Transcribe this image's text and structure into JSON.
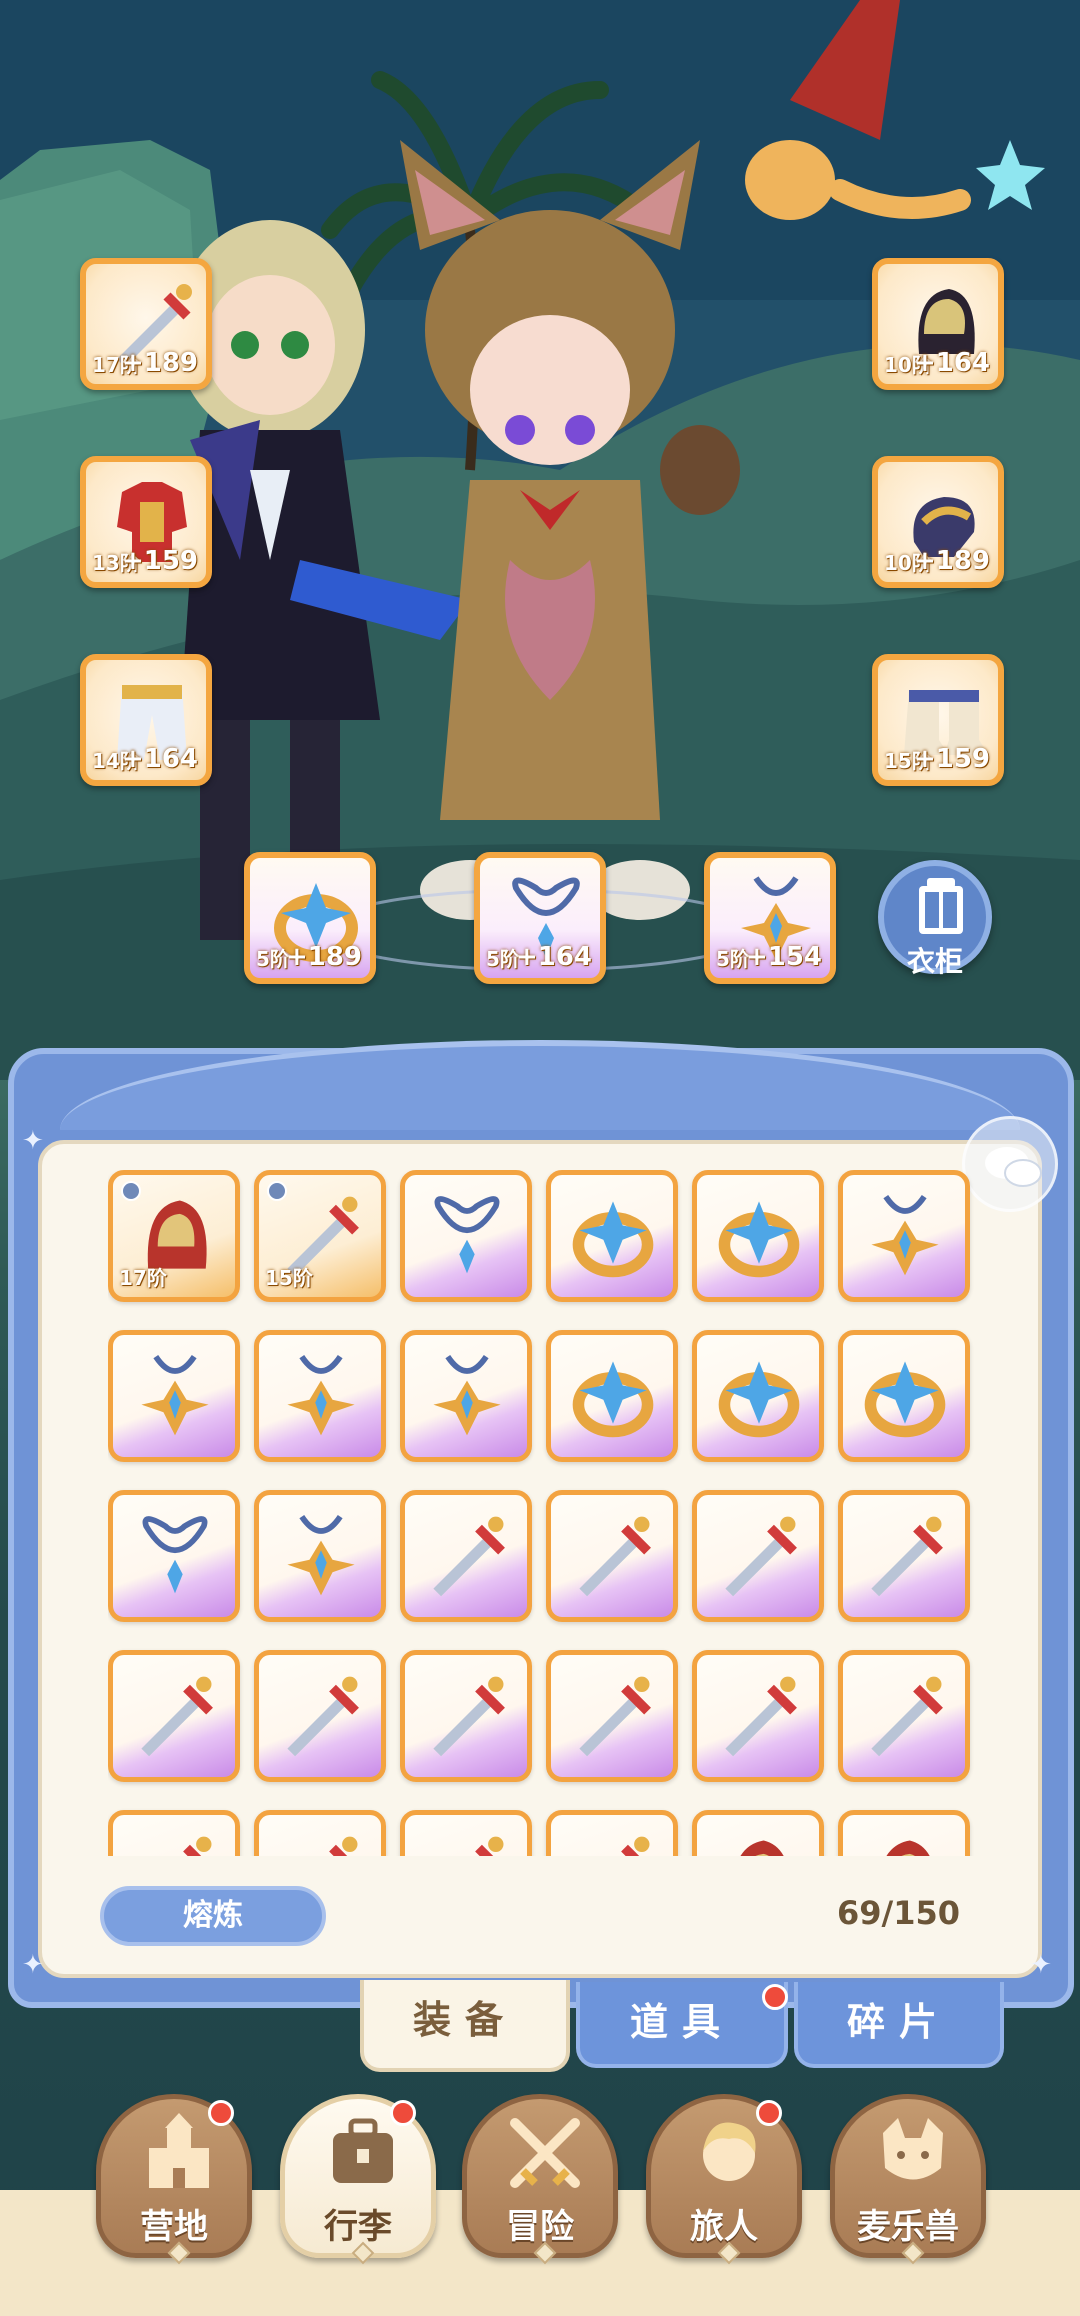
{
  "equipped": {
    "left": [
      {
        "level": "17阶",
        "bonus": "+189",
        "icon": "sword-icon"
      },
      {
        "level": "13阶",
        "bonus": "+159",
        "icon": "armor-icon"
      },
      {
        "level": "14阶",
        "bonus": "+164",
        "icon": "pants-icon"
      }
    ],
    "right": [
      {
        "level": "10阶",
        "bonus": "+164",
        "icon": "helmet-icon"
      },
      {
        "level": "10阶",
        "bonus": "+189",
        "icon": "gloves-icon"
      },
      {
        "level": "15阶",
        "bonus": "+159",
        "icon": "boots-icon"
      }
    ],
    "bottom": [
      {
        "level": "5阶",
        "bonus": "+189",
        "icon": "ring-icon"
      },
      {
        "level": "5阶",
        "bonus": "+164",
        "icon": "necklace-icon"
      },
      {
        "level": "5阶",
        "bonus": "+154",
        "icon": "amulet-icon"
      }
    ]
  },
  "wardrobe": {
    "label": "衣柜"
  },
  "inventory": {
    "smelt_label": "熔炼",
    "capacity": "69/150",
    "items": [
      {
        "type": "helmet",
        "rarity": "orange",
        "level": "17阶",
        "locked": true
      },
      {
        "type": "sword",
        "rarity": "orange",
        "level": "15阶",
        "locked": true
      },
      {
        "type": "necklace",
        "rarity": "purple"
      },
      {
        "type": "ring",
        "rarity": "purple"
      },
      {
        "type": "ring",
        "rarity": "purple"
      },
      {
        "type": "amulet",
        "rarity": "purple"
      },
      {
        "type": "amulet",
        "rarity": "purple"
      },
      {
        "type": "amulet",
        "rarity": "purple"
      },
      {
        "type": "amulet",
        "rarity": "purple"
      },
      {
        "type": "ring",
        "rarity": "purple"
      },
      {
        "type": "ring",
        "rarity": "purple"
      },
      {
        "type": "ring",
        "rarity": "purple"
      },
      {
        "type": "necklace",
        "rarity": "purple"
      },
      {
        "type": "amulet",
        "rarity": "purple"
      },
      {
        "type": "sword",
        "rarity": "purple"
      },
      {
        "type": "sword",
        "rarity": "purple"
      },
      {
        "type": "sword",
        "rarity": "purple"
      },
      {
        "type": "sword",
        "rarity": "purple"
      },
      {
        "type": "sword",
        "rarity": "purple"
      },
      {
        "type": "sword",
        "rarity": "purple"
      },
      {
        "type": "sword",
        "rarity": "purple"
      },
      {
        "type": "sword",
        "rarity": "purple"
      },
      {
        "type": "sword",
        "rarity": "purple"
      },
      {
        "type": "sword",
        "rarity": "purple"
      },
      {
        "type": "sword",
        "rarity": "purple"
      },
      {
        "type": "sword",
        "rarity": "purple"
      },
      {
        "type": "sword",
        "rarity": "purple"
      },
      {
        "type": "sword",
        "rarity": "purple"
      },
      {
        "type": "helmet",
        "rarity": "purple"
      },
      {
        "type": "helmet",
        "rarity": "purple"
      }
    ]
  },
  "subtabs": [
    {
      "label": "装备",
      "active": true,
      "badge": false
    },
    {
      "label": "道具",
      "active": false,
      "badge": true
    },
    {
      "label": "碎片",
      "active": false,
      "badge": false
    }
  ],
  "nav": [
    {
      "label": "营地",
      "icon": "castle-icon",
      "active": false,
      "badge": true
    },
    {
      "label": "行李",
      "icon": "bag-icon",
      "active": true,
      "badge": true
    },
    {
      "label": "冒险",
      "icon": "crossed-swords-icon",
      "active": false,
      "badge": false
    },
    {
      "label": "旅人",
      "icon": "traveler-icon",
      "active": false,
      "badge": true
    },
    {
      "label": "麦乐兽",
      "icon": "cat-icon",
      "active": false,
      "badge": false
    }
  ],
  "colors": {
    "orange_frame": "#f3a340",
    "purple_glow": "#c98be8",
    "panel_blue": "#6f93d6",
    "badge_red": "#ee4b3b"
  }
}
